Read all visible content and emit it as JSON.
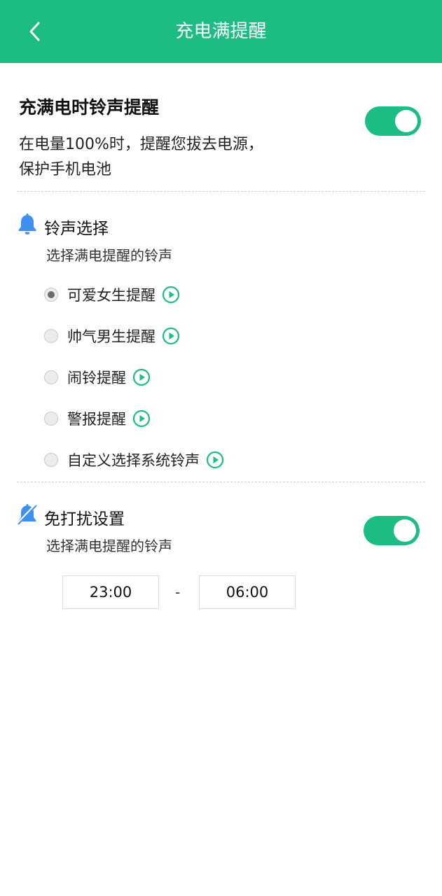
{
  "header": {
    "title": "充电满提醒",
    "back_icon": "chevron-left-icon"
  },
  "main": {
    "title": "充满电时铃声提醒",
    "description_line1": "在电量100%时，提醒您拔去电源，",
    "description_line2": "保护手机电池",
    "enabled": true
  },
  "ringtone": {
    "title": "铃声选择",
    "subtitle": "选择满电提醒的铃声",
    "icon": "bell-icon",
    "options": [
      {
        "label": "可爱女生提醒",
        "selected": true
      },
      {
        "label": "帅气男生提醒",
        "selected": false
      },
      {
        "label": "闹铃提醒",
        "selected": false
      },
      {
        "label": "警报提醒",
        "selected": false
      },
      {
        "label": "自定义选择系统铃声",
        "selected": false
      }
    ]
  },
  "dnd": {
    "title": "免打扰设置",
    "subtitle": "选择满电提醒的铃声",
    "icon": "bell-off-icon",
    "enabled": true,
    "start": "23:00",
    "separator": "-",
    "end": "06:00"
  },
  "colors": {
    "accent": "#1cbd83",
    "icon_blue": "#3d8ff0"
  }
}
